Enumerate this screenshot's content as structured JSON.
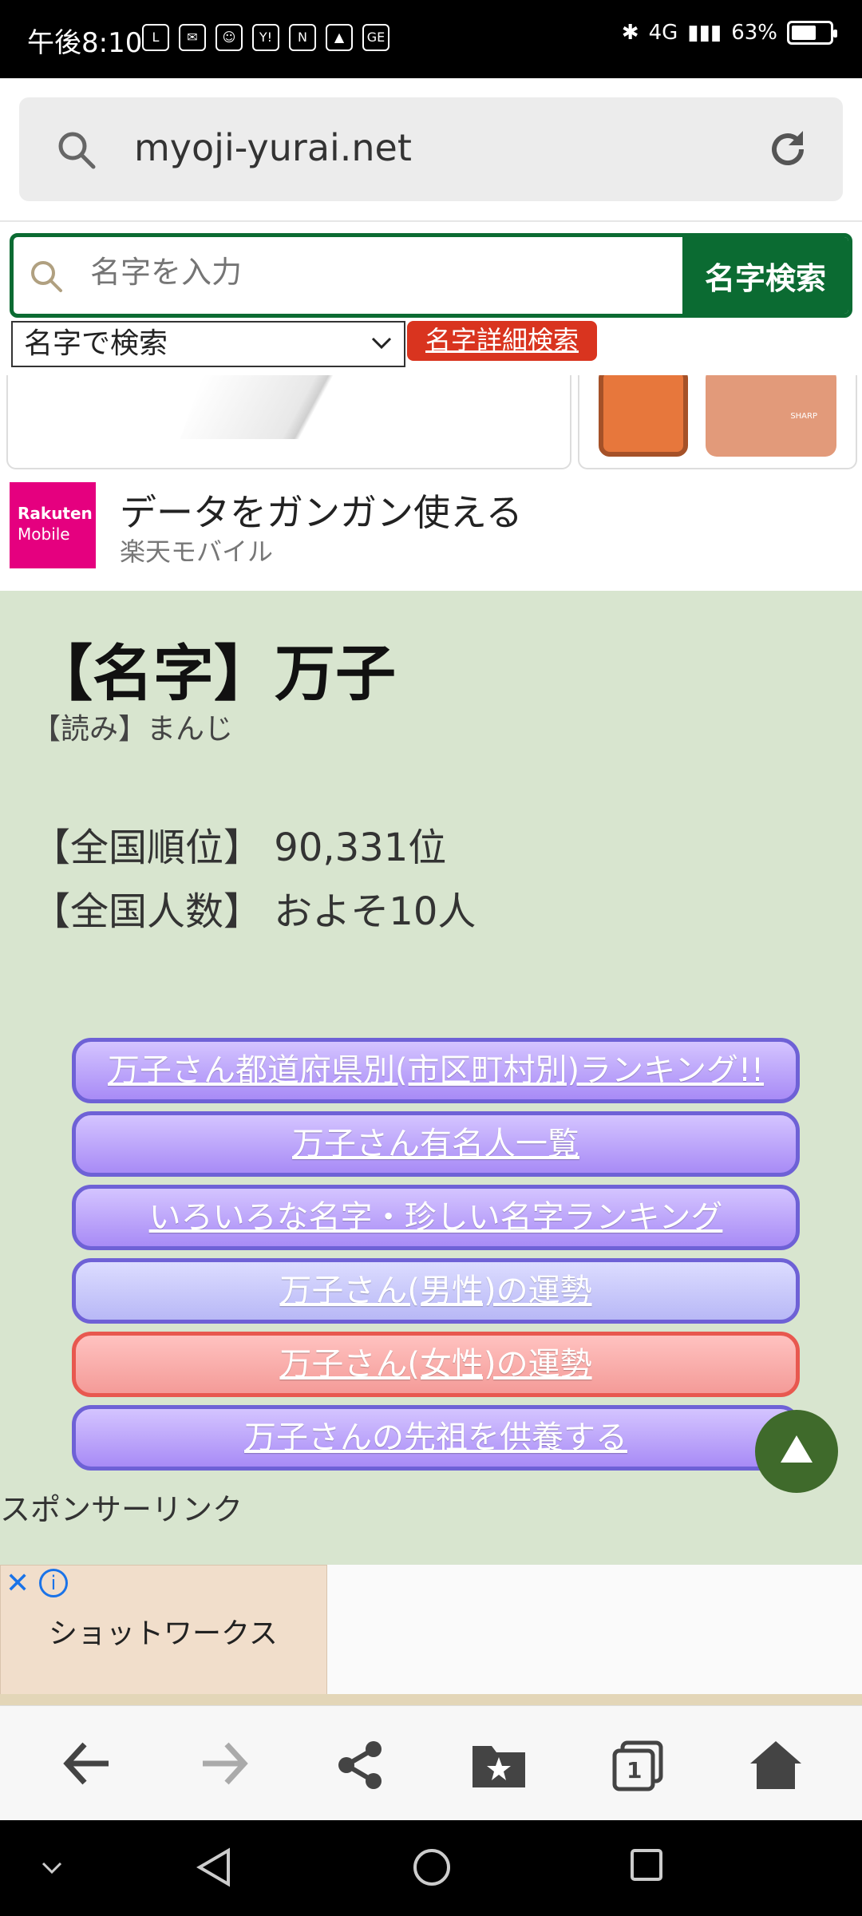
{
  "status_bar": {
    "time": "午後8:10",
    "notification_icons": [
      "LINE",
      "mail-icon",
      "face-icon",
      "Y!",
      "news-icon",
      "gallery-icon",
      "GE"
    ],
    "network": "4G",
    "battery": "63%"
  },
  "browser": {
    "url": "myoji-yurai.net"
  },
  "site_search": {
    "placeholder": "名字を入力",
    "button_label": "名字検索",
    "select_value": "名字で検索",
    "detail_search_label": "名字詳細検索"
  },
  "ad": {
    "logo_line1": "Rakuten",
    "logo_line2": "Mobile",
    "title": "データをガンガン使える",
    "advertiser": "楽天モバイル",
    "phone_brand": "SHARP"
  },
  "surname": {
    "title": "【名字】万子",
    "reading": "【読み】まんじ",
    "rank_label": "【全国順位】",
    "rank_value": "90,331位",
    "count_label": "【全国人数】",
    "count_value": "およそ10人"
  },
  "links": [
    {
      "label": "万子さん都道府県別(市区町村別)ランキング!!",
      "style": "purple"
    },
    {
      "label": "万子さん有名人一覧",
      "style": "purple"
    },
    {
      "label": "いろいろな名字・珍しい名字ランキング",
      "style": "purple"
    },
    {
      "label": "万子さん(男性)の運勢",
      "style": "lilac"
    },
    {
      "label": "万子さん(女性)の運勢",
      "style": "pink"
    },
    {
      "label": "万子さんの先祖を供養する",
      "style": "purple"
    }
  ],
  "sponsor_label": "スポンサーリンク",
  "bottom_ad": {
    "close_icon": "close-icon",
    "info_icon": "info-icon",
    "name": "ショットワークス"
  },
  "toolbar_icons": [
    "back-arrow-icon",
    "forward-arrow-icon",
    "share-icon",
    "bookmarks-icon",
    "tabs-icon",
    "home-icon"
  ],
  "tabs_count": "1",
  "colors": {
    "brand_green": "#0b6b32",
    "content_bg": "#d8e5cf",
    "link_purple": "#a88bf6",
    "link_pink": "#f49b98",
    "detail_red": "#d9341f",
    "rakuten_pink": "#e5007f"
  }
}
